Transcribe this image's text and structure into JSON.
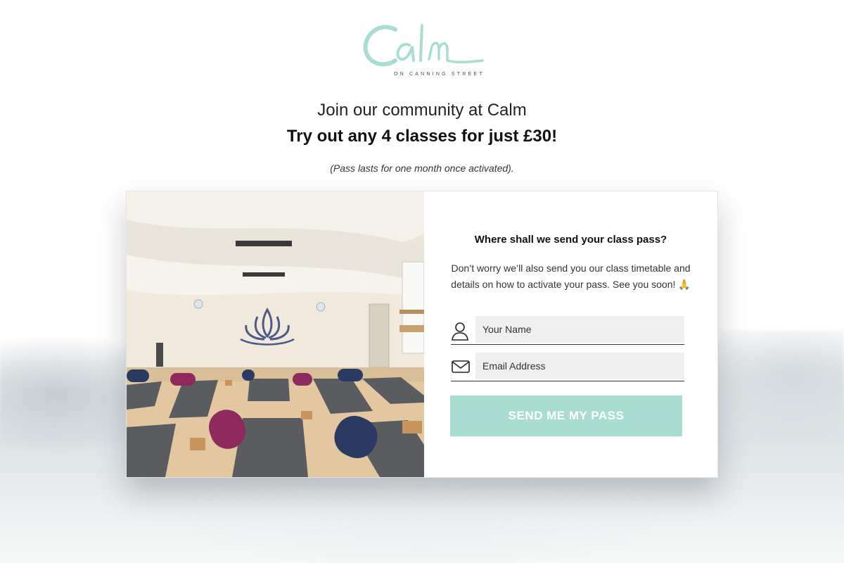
{
  "brand": {
    "logo_text": "Calm",
    "logo_subtitle": "ON CANNING STREET",
    "logo_color": "#a9ddd2"
  },
  "hero": {
    "headline": "Join our community at Calm",
    "offer": "Try out any 4 classes for just £30!",
    "note": "(Pass lasts for one month once activated)."
  },
  "form": {
    "title": "Where shall we send your class pass?",
    "description": "Don’t worry we’ll also send you our class timetable and details on how to activate your pass. See you soon! 🙏",
    "name_placeholder": "Your Name",
    "name_value": "",
    "email_placeholder": "Email Address",
    "email_value": "",
    "name_icon": "user-icon",
    "email_icon": "envelope-icon",
    "submit_label": "SEND ME MY PASS",
    "submit_color": "#a9ddd2"
  },
  "photo": {
    "subject": "yoga-studio-photo"
  }
}
